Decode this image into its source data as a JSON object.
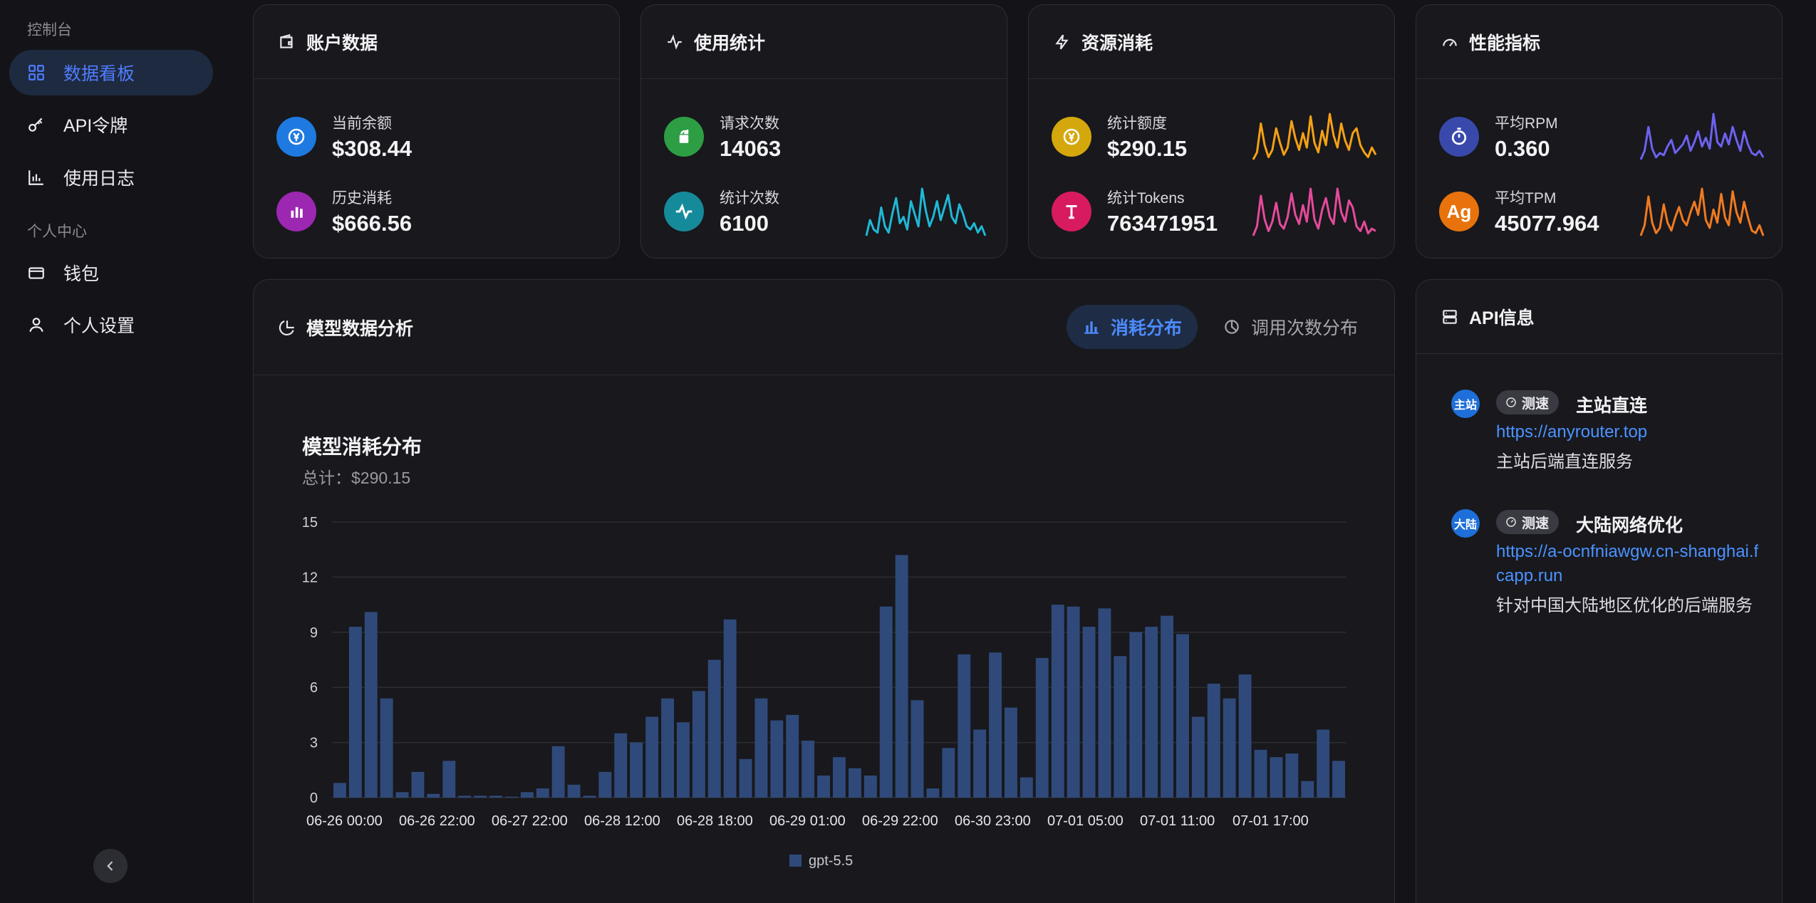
{
  "sidebar": {
    "section1": "控制台",
    "section2": "个人中心",
    "items": [
      {
        "label": "数据看板"
      },
      {
        "label": "API令牌"
      },
      {
        "label": "使用日志"
      },
      {
        "label": "钱包"
      },
      {
        "label": "个人设置"
      }
    ]
  },
  "cards": {
    "account": {
      "title": "账户数据",
      "balance_label": "当前余额",
      "balance_value": "$308.44",
      "history_label": "历史消耗",
      "history_value": "$666.56"
    },
    "usage": {
      "title": "使用统计",
      "requests_label": "请求次数",
      "requests_value": "14063",
      "count_label": "统计次数",
      "count_value": "6100"
    },
    "resource": {
      "title": "资源消耗",
      "quota_label": "统计额度",
      "quota_value": "$290.15",
      "tokens_label": "统计Tokens",
      "tokens_value": "763471951"
    },
    "perf": {
      "title": "性能指标",
      "rpm_label": "平均RPM",
      "rpm_value": "0.360",
      "tpm_label": "平均TPM",
      "tpm_value": "45077.964",
      "tpm_icon_text": "Ag"
    }
  },
  "analysis": {
    "title": "模型数据分析",
    "tab_consume": "消耗分布",
    "tab_calls": "调用次数分布"
  },
  "api": {
    "title": "API信息",
    "speed_label": "测速",
    "entries": [
      {
        "badge": "主站",
        "name": "主站直连",
        "url": "https://anyrouter.top",
        "desc": "主站后端直连服务"
      },
      {
        "badge": "大陆",
        "name": "大陆网络优化",
        "url": "https://a-ocnfniawgw.cn-shanghai.fcapp.run",
        "desc": "针对中国大陆地区优化的后端服务"
      }
    ]
  },
  "colors": {
    "accent": "#4f7dff",
    "bar": "#2f4a7a",
    "cyan": "#1fb8d6",
    "orange": "#f5a014",
    "pink": "#e64a9b",
    "purple": "#6d62f0",
    "amber": "#f07a20"
  },
  "chart_data": {
    "type": "bar",
    "title": "模型消耗分布",
    "subtitle": "总计：$290.15",
    "ylim": [
      0,
      15
    ],
    "yticks": [
      0,
      3,
      6,
      9,
      12,
      15
    ],
    "xtick_labels": [
      "06-26 00:00",
      "06-26 22:00",
      "06-27 22:00",
      "06-28 12:00",
      "06-28 18:00",
      "06-29 01:00",
      "06-29 22:00",
      "06-30 23:00",
      "07-01 05:00",
      "07-01 11:00",
      "07-01 17:00"
    ],
    "series": [
      {
        "name": "gpt-5.5",
        "values": [
          0.8,
          9.3,
          10.1,
          5.4,
          0.3,
          1.4,
          0.2,
          2.0,
          0.1,
          0.1,
          0.1,
          0.05,
          0.3,
          0.5,
          2.8,
          0.7,
          0.1,
          1.4,
          3.5,
          3.0,
          4.4,
          5.4,
          4.1,
          5.8,
          7.5,
          9.7,
          2.1,
          5.4,
          4.2,
          4.5,
          3.1,
          1.2,
          2.2,
          1.6,
          1.2,
          10.4,
          13.2,
          5.3,
          0.5,
          2.7,
          7.8,
          3.7,
          7.9,
          4.9,
          1.1,
          7.6,
          10.5,
          10.4,
          9.3,
          10.3,
          7.7,
          9.0,
          9.3,
          9.9,
          8.9,
          4.4,
          6.2,
          5.4,
          6.7,
          2.6,
          2.2,
          2.4,
          0.9,
          3.7,
          2.0
        ]
      }
    ],
    "legend": "bottom",
    "grid": true
  },
  "sparklines": {
    "count": [
      3,
      8,
      5,
      4,
      12,
      6,
      4,
      10,
      15,
      7,
      9,
      5,
      14,
      10,
      6,
      18,
      11,
      6,
      9,
      14,
      8,
      12,
      16,
      9,
      7,
      13,
      10,
      6,
      5,
      7,
      4,
      6,
      3
    ],
    "quota": [
      3,
      6,
      18,
      9,
      4,
      7,
      16,
      10,
      5,
      8,
      19,
      12,
      7,
      14,
      8,
      21,
      10,
      6,
      15,
      9,
      22,
      13,
      8,
      18,
      11,
      7,
      14,
      16,
      9,
      6,
      4,
      8,
      5
    ],
    "tokens": [
      3,
      7,
      20,
      10,
      5,
      9,
      17,
      8,
      6,
      11,
      21,
      12,
      8,
      16,
      9,
      23,
      10,
      6,
      14,
      19,
      11,
      8,
      23,
      13,
      9,
      18,
      15,
      7,
      5,
      9,
      4,
      6,
      5
    ],
    "rpm": [
      3,
      7,
      18,
      8,
      4,
      6,
      5,
      9,
      12,
      6,
      8,
      10,
      14,
      7,
      11,
      16,
      9,
      13,
      8,
      24,
      11,
      9,
      15,
      10,
      18,
      12,
      7,
      16,
      10,
      6,
      5,
      7,
      4
    ],
    "tpm": [
      4,
      8,
      19,
      9,
      5,
      7,
      16,
      9,
      6,
      11,
      15,
      10,
      8,
      13,
      17,
      12,
      22,
      10,
      7,
      14,
      9,
      20,
      11,
      8,
      21,
      13,
      9,
      17,
      11,
      6,
      5,
      8,
      4
    ]
  }
}
